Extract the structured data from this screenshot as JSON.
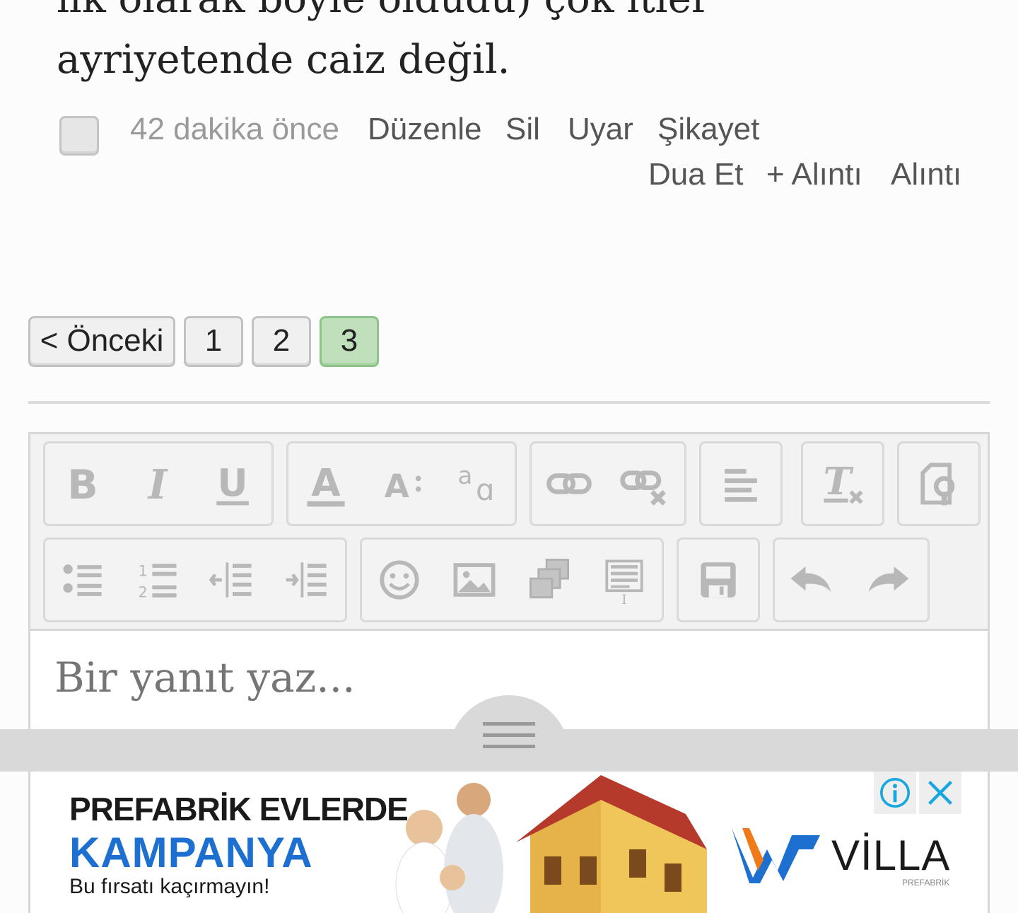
{
  "post": {
    "text_lines": [
      "ilk olarak böyle oldudu) çok itler",
      "ayriyetende caiz değil."
    ]
  },
  "meta": {
    "time": "42 dakika önce",
    "edit": "Düzenle",
    "delete": "Sil",
    "warn": "Uyar",
    "report": "Şikayet",
    "pray": "Dua Et",
    "add_quote": "+ Alıntı",
    "quote": "Alıntı"
  },
  "pagination": {
    "prev": "< Önceki",
    "pages": [
      "1",
      "2",
      "3"
    ],
    "current": "3"
  },
  "editor": {
    "placeholder": "Bir yanıt yaz...",
    "toolbar_icons": [
      [
        "bold-icon",
        "italic-icon",
        "underline-icon"
      ],
      [
        "text-color-icon",
        "font-size-icon",
        "text-case-icon"
      ],
      [
        "link-icon",
        "unlink-icon"
      ],
      [
        "align-left-icon"
      ],
      [
        "remove-format-icon"
      ],
      [
        "source-icon"
      ],
      [
        "bulleted-list-icon",
        "numbered-list-icon",
        "outdent-icon",
        "indent-icon"
      ],
      [
        "emoji-icon",
        "image-icon",
        "gallery-icon",
        "template-icon"
      ],
      [
        "save-icon"
      ],
      [
        "undo-icon",
        "redo-icon"
      ]
    ]
  },
  "ad": {
    "line1": "PREFABRİK EVLERDE",
    "line2": "KAMPANYA",
    "line3": "Bu fırsatı kaçırmayın!",
    "brand": "VİLLA",
    "brand_sub": "PREFABRİK",
    "icons": [
      "info-icon",
      "close-icon"
    ]
  },
  "colors": {
    "active_page": "#bfe0bb",
    "ad_blue": "#1d6fd0",
    "ad_close": "#17a6e0"
  }
}
